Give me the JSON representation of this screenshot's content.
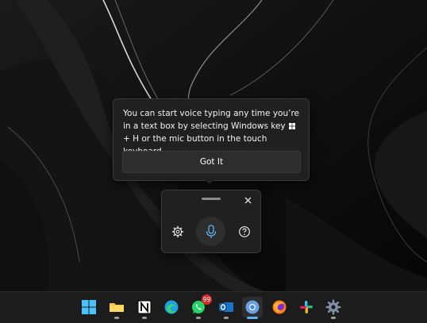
{
  "tooltip": {
    "text_before": "You can start voice typing any time you’re in a text box by selecting Windows key",
    "text_after": "+ H or the mic button in the touch keyboard.",
    "button_label": "Got It"
  },
  "voice_panel": {
    "icons": [
      "drag-handle",
      "close-icon",
      "gear-icon",
      "microphone-icon",
      "help-icon"
    ]
  },
  "taskbar": {
    "items": [
      {
        "name": "start",
        "icon": "windows-logo-icon"
      },
      {
        "name": "file-explorer",
        "icon": "folder-icon"
      },
      {
        "name": "notion",
        "icon": "notion-icon"
      },
      {
        "name": "edge",
        "icon": "edge-icon"
      },
      {
        "name": "whatsapp",
        "icon": "whatsapp-icon",
        "badge": "99"
      },
      {
        "name": "outlook",
        "icon": "outlook-icon"
      },
      {
        "name": "chrome",
        "icon": "chrome-icon",
        "active": true
      },
      {
        "name": "firefox",
        "icon": "firefox-icon"
      },
      {
        "name": "slack",
        "icon": "slack-icon"
      },
      {
        "name": "settings",
        "icon": "gear-icon"
      }
    ]
  },
  "colors": {
    "accent": "#5fb2f2",
    "panel_bg": "#202020",
    "badge": "#d42a2a"
  }
}
